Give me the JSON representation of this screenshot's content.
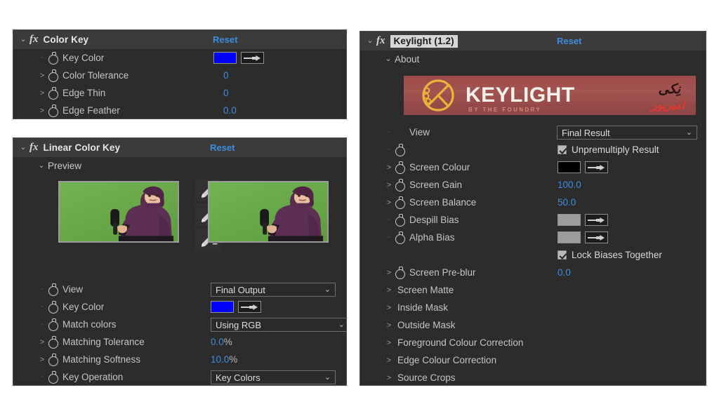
{
  "app": {
    "background": "#ffffff",
    "panel_bg": "#2c2c2c",
    "header_bg": "#3b3b3b",
    "accent_blue": "#3c8de0",
    "label_color": "#c4c4c4"
  },
  "color_key_panel": {
    "fx_glyph": "fx",
    "title": "Color Key",
    "reset_label": "Reset",
    "expand_triangle": "⌄",
    "rows": [
      {
        "label": "Key Color",
        "type": "color",
        "arrow": "-",
        "swatch": "#0000ff",
        "eyedropper": "eyedropper-icon"
      },
      {
        "label": "Color Tolerance",
        "type": "number",
        "arrow": ">",
        "value": "0"
      },
      {
        "label": "Edge Thin",
        "type": "number",
        "arrow": ">",
        "value": "0"
      },
      {
        "label": "Edge Feather",
        "type": "number",
        "arrow": ">",
        "value": "0.0"
      }
    ]
  },
  "linear_color_key_panel": {
    "fx_glyph": "fx",
    "title": "Linear Color Key",
    "reset_label": "Reset",
    "expand_triangle": "⌄",
    "preview": {
      "label": "Preview",
      "triangle": "⌄",
      "source_thumbnail": "green-screen-source-thumbnail",
      "result_thumbnail": "green-screen-result-thumbnail",
      "screen_color": "#6aa94a",
      "subject_color": "#5d2f52",
      "eyedroppers": [
        {
          "name": "eyedropper-sample",
          "sign": ""
        },
        {
          "name": "eyedropper-add",
          "sign": "+"
        },
        {
          "name": "eyedropper-subtract",
          "sign": "−"
        }
      ]
    },
    "rows": [
      {
        "label": "View",
        "type": "dropdown",
        "arrow": "-",
        "value": "Final Output",
        "chevron": "⌄"
      },
      {
        "label": "Key Color",
        "type": "color",
        "arrow": "-",
        "swatch": "#0000ff",
        "eyedropper": "eyedropper-icon"
      },
      {
        "label": "Match colors",
        "type": "dropdown",
        "arrow": "-",
        "value": "Using RGB",
        "chevron": "⌄"
      },
      {
        "label": "Matching Tolerance",
        "type": "number",
        "arrow": ">",
        "value": "0.0",
        "unit": "%"
      },
      {
        "label": "Matching Softness",
        "type": "number",
        "arrow": ">",
        "value": "10.0",
        "unit": "%"
      },
      {
        "label": "Key Operation",
        "type": "dropdown",
        "arrow": "-",
        "value": "Key Colors",
        "chevron": "⌄"
      }
    ]
  },
  "keylight_panel": {
    "fx_glyph": "fx",
    "title": "Keylight (1.2)",
    "title_selected": true,
    "reset_label": "Reset",
    "expand_triangle": "⌄",
    "about": {
      "label": "About",
      "triangle": "⌄",
      "banner": {
        "logo_name": "keylight-circle-logo",
        "wordmark": "KEYLIGHT",
        "tagline": "BY THE FOUNDRY",
        "persian_top": "نِکی",
        "persian_bottom": "امیرپور",
        "bg_color": "#9c4b49",
        "logo_color": "#e8b43a"
      }
    },
    "rows": [
      {
        "label": "View",
        "type": "dropdown",
        "arrow": "-",
        "value": "Final Result",
        "chevron": "⌄"
      },
      {
        "label": "",
        "type": "checkbox",
        "arrow": "-",
        "checkbox_label": "Unpremultiply Result",
        "checked": true
      },
      {
        "label": "Screen Colour",
        "type": "color",
        "arrow": ">",
        "swatch": "#000000",
        "eyedropper": "eyedropper-icon"
      },
      {
        "label": "Screen Gain",
        "type": "number",
        "arrow": ">",
        "value": "100.0"
      },
      {
        "label": "Screen Balance",
        "type": "number",
        "arrow": ">",
        "value": "50.0"
      },
      {
        "label": "Despill Bias",
        "type": "color",
        "arrow": "-",
        "swatch": "#9c9c9c",
        "eyedropper": "eyedropper-icon"
      },
      {
        "label": "Alpha Bias",
        "type": "color",
        "arrow": "-",
        "swatch": "#9c9c9c",
        "eyedropper": "eyedropper-icon"
      },
      {
        "label": "",
        "type": "checkbox",
        "arrow": "-",
        "checkbox_label": "Lock Biases Together",
        "checked": true
      },
      {
        "label": "Screen Pre-blur",
        "type": "number",
        "arrow": ">",
        "value": "0.0"
      }
    ],
    "groups": [
      {
        "label": "Screen Matte",
        "arrow": ">"
      },
      {
        "label": "Inside Mask",
        "arrow": ">"
      },
      {
        "label": "Outside Mask",
        "arrow": ">"
      },
      {
        "label": "Foreground Colour Correction",
        "arrow": ">"
      },
      {
        "label": "Edge Colour Correction",
        "arrow": ">"
      },
      {
        "label": "Source Crops",
        "arrow": ">"
      }
    ]
  }
}
